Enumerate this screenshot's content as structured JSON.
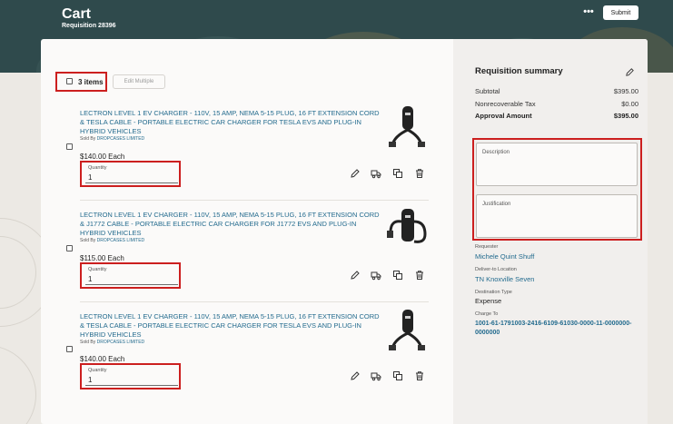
{
  "header": {
    "title": "Cart",
    "subtitle": "Requisition 28396",
    "more_label": "•••",
    "submit_label": "Submit"
  },
  "toolbar": {
    "items_count": "3 items",
    "edit_multiple_label": "Edit Multiple"
  },
  "items": [
    {
      "title": "LECTRON LEVEL 1 EV CHARGER - 110V, 15 AMP, NEMA 5-15 PLUG, 16 FT EXTENSION CORD & TESLA CABLE - PORTABLE ELECTRIC CAR CHARGER FOR TESLA EVS AND PLUG-IN HYBRID VEHICLES",
      "sold_by_label": "Sold By",
      "supplier": "DROPCASES LIMITED",
      "price": "$140.00 Each",
      "quantity_label": "Quantity",
      "quantity": "1"
    },
    {
      "title": "LECTRON LEVEL 1 EV CHARGER - 110V, 15 AMP, NEMA 5-15 PLUG, 16 FT EXTENSION CORD & J1772 CABLE - PORTABLE ELECTRIC CAR CHARGER FOR J1772 EVS AND PLUG-IN HYBRID VEHICLES",
      "sold_by_label": "Sold By",
      "supplier": "DROPCASES LIMITED",
      "price": "$115.00 Each",
      "quantity_label": "Quantity",
      "quantity": "1"
    },
    {
      "title": "LECTRON LEVEL 1 EV CHARGER - 110V, 15 AMP, NEMA 5-15 PLUG, 16 FT EXTENSION CORD & TESLA CABLE - PORTABLE ELECTRIC CAR CHARGER FOR TESLA EVS AND PLUG-IN HYBRID VEHICLES",
      "sold_by_label": "Sold By",
      "supplier": "DROPCASES LIMITED",
      "price": "$140.00 Each",
      "quantity_label": "Quantity",
      "quantity": "1"
    }
  ],
  "summary": {
    "title": "Requisition summary",
    "subtotal_label": "Subtotal",
    "subtotal": "$395.00",
    "tax_label": "Nonrecoverable Tax",
    "tax": "$0.00",
    "approval_label": "Approval Amount",
    "approval": "$395.00",
    "description_label": "Description",
    "justification_label": "Justification",
    "requester_label": "Requester",
    "requester": "Michele Quint Shuff",
    "deliver_label": "Deliver-to Location",
    "deliver": "TN Knoxville Seven",
    "destination_label": "Destination Type",
    "destination": "Expense",
    "charge_label": "Charge To",
    "charge": "1001-61-1791003-2416-6109-61030-0000-11-0000000-0000000"
  },
  "colors": {
    "banner": "#2f4a4c",
    "link": "#236b8e",
    "highlight": "#cc1f1f"
  }
}
